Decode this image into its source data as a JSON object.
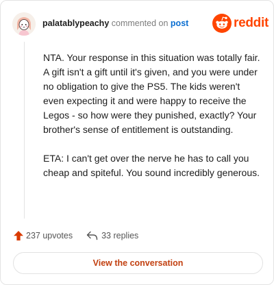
{
  "header": {
    "username": "palatablypeachy",
    "commented_text": "commented on",
    "post_link": "post"
  },
  "brand": {
    "wordmark": "reddit",
    "color": "#ff4500"
  },
  "comment": {
    "paragraphs": [
      "NTA. Your response in this situation was totally fair. A gift isn't a gift until it's given, and you were under no obligation to give the PS5. The kids weren't even expecting it and were happy to receive the Legos - so how were they punished, exactly? Your brother's sense of entitlement is outstanding.",
      "ETA: I can't get over the nerve he has to call you cheap and spiteful. You sound incredibly generous."
    ]
  },
  "actions": {
    "upvotes": "237 upvotes",
    "replies": "33 replies",
    "upvote_color": "#d93a00"
  },
  "footer": {
    "view_button": "View the conversation"
  },
  "icons": {
    "avatar": "avatar-icon",
    "logo": "reddit-snoo-icon",
    "upvote": "upvote-arrow-icon",
    "reply": "reply-arrow-icon"
  }
}
